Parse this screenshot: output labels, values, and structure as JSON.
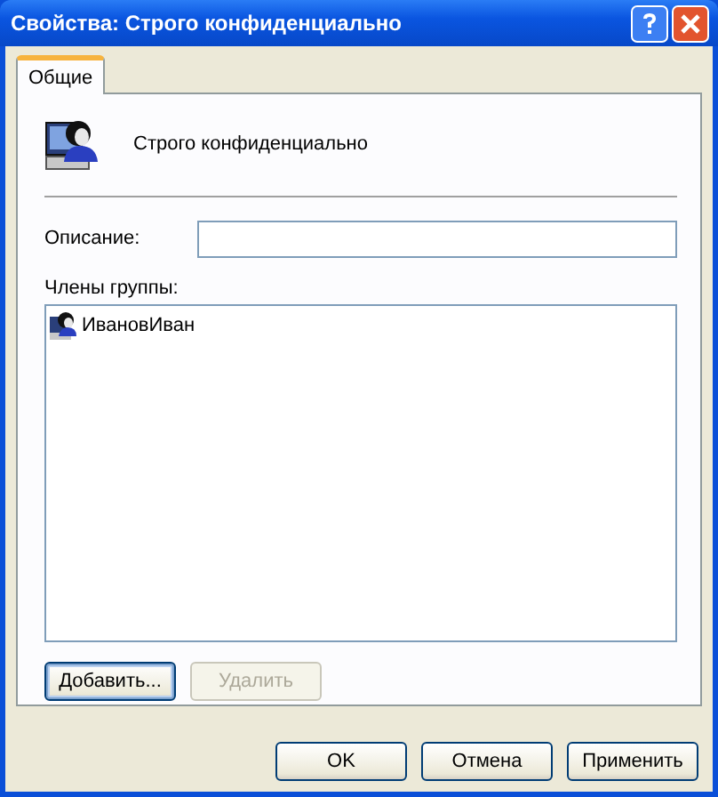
{
  "window": {
    "title": "Свойства: Строго конфиденциально"
  },
  "tabs": [
    {
      "label": "Общие",
      "selected": true
    }
  ],
  "group": {
    "name": "Строго конфиденциально"
  },
  "description": {
    "label": "Описание:"
  },
  "members": {
    "label": "Члены группы:",
    "items": [
      {
        "name": "ИвановИван",
        "selected": false
      }
    ]
  },
  "member_buttons": [
    {
      "label": "Добавить...",
      "disabled": false
    },
    {
      "label": "Удалить",
      "disabled": true
    }
  ],
  "footer_buttons": [
    {
      "label": "OK"
    },
    {
      "label": "Отмена"
    },
    {
      "label": "Применить"
    }
  ]
}
